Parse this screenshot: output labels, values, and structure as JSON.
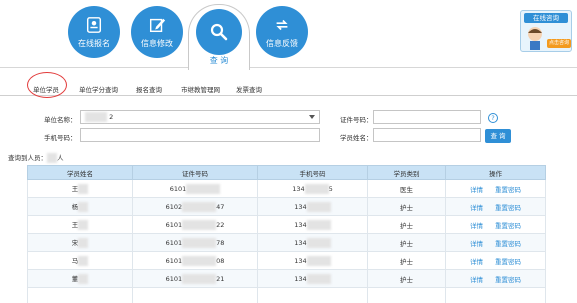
{
  "nav": {
    "items": [
      {
        "label": "在线报名",
        "icon": "id-card-icon"
      },
      {
        "label": "信息修改",
        "icon": "edit-icon"
      },
      {
        "label": "查 询",
        "icon": "search-icon"
      },
      {
        "label": "信息反馈",
        "icon": "refresh-icon"
      }
    ],
    "help_title": "在线咨询",
    "help_sub": "点击咨询"
  },
  "subtabs": [
    "单位学员",
    "单位学分查询",
    "报名查询",
    "市继教管理网",
    "发票查询"
  ],
  "form": {
    "unit_label": "单位名称：",
    "unit_value": "2",
    "id_label": "证件号码：",
    "phone_label": "手机号码：",
    "name_label": "学员姓名：",
    "help_symbol": "?",
    "query_button": "查 询"
  },
  "result": {
    "prefix": "查询到人员：",
    "suffix": "人"
  },
  "table": {
    "headers": [
      "学员姓名",
      "证件号码",
      "手机号码",
      "学员类别",
      "操作"
    ],
    "action_detail": "详情",
    "action_reset": "重置密码",
    "rows": [
      {
        "name": "王",
        "id_prefix": "6101",
        "id_suffix": "",
        "phone_prefix": "134",
        "phone_suffix": "5",
        "category": "医生"
      },
      {
        "name": "杨",
        "id_prefix": "6102",
        "id_suffix": "47",
        "phone_prefix": "134",
        "phone_suffix": "",
        "category": "护士"
      },
      {
        "name": "王",
        "id_prefix": "6101",
        "id_suffix": "22",
        "phone_prefix": "134",
        "phone_suffix": "",
        "category": "护士"
      },
      {
        "name": "宋",
        "id_prefix": "6101",
        "id_suffix": "78",
        "phone_prefix": "134",
        "phone_suffix": "",
        "category": "护士"
      },
      {
        "name": "马",
        "id_prefix": "6101",
        "id_suffix": "08",
        "phone_prefix": "134",
        "phone_suffix": "",
        "category": "护士"
      },
      {
        "name": "董",
        "id_prefix": "6101",
        "id_suffix": "21",
        "phone_prefix": "134",
        "phone_suffix": "",
        "category": "护士"
      },
      {
        "name": "",
        "id_prefix": "",
        "id_suffix": "",
        "phone_prefix": "",
        "phone_suffix": "",
        "category": ""
      }
    ]
  }
}
